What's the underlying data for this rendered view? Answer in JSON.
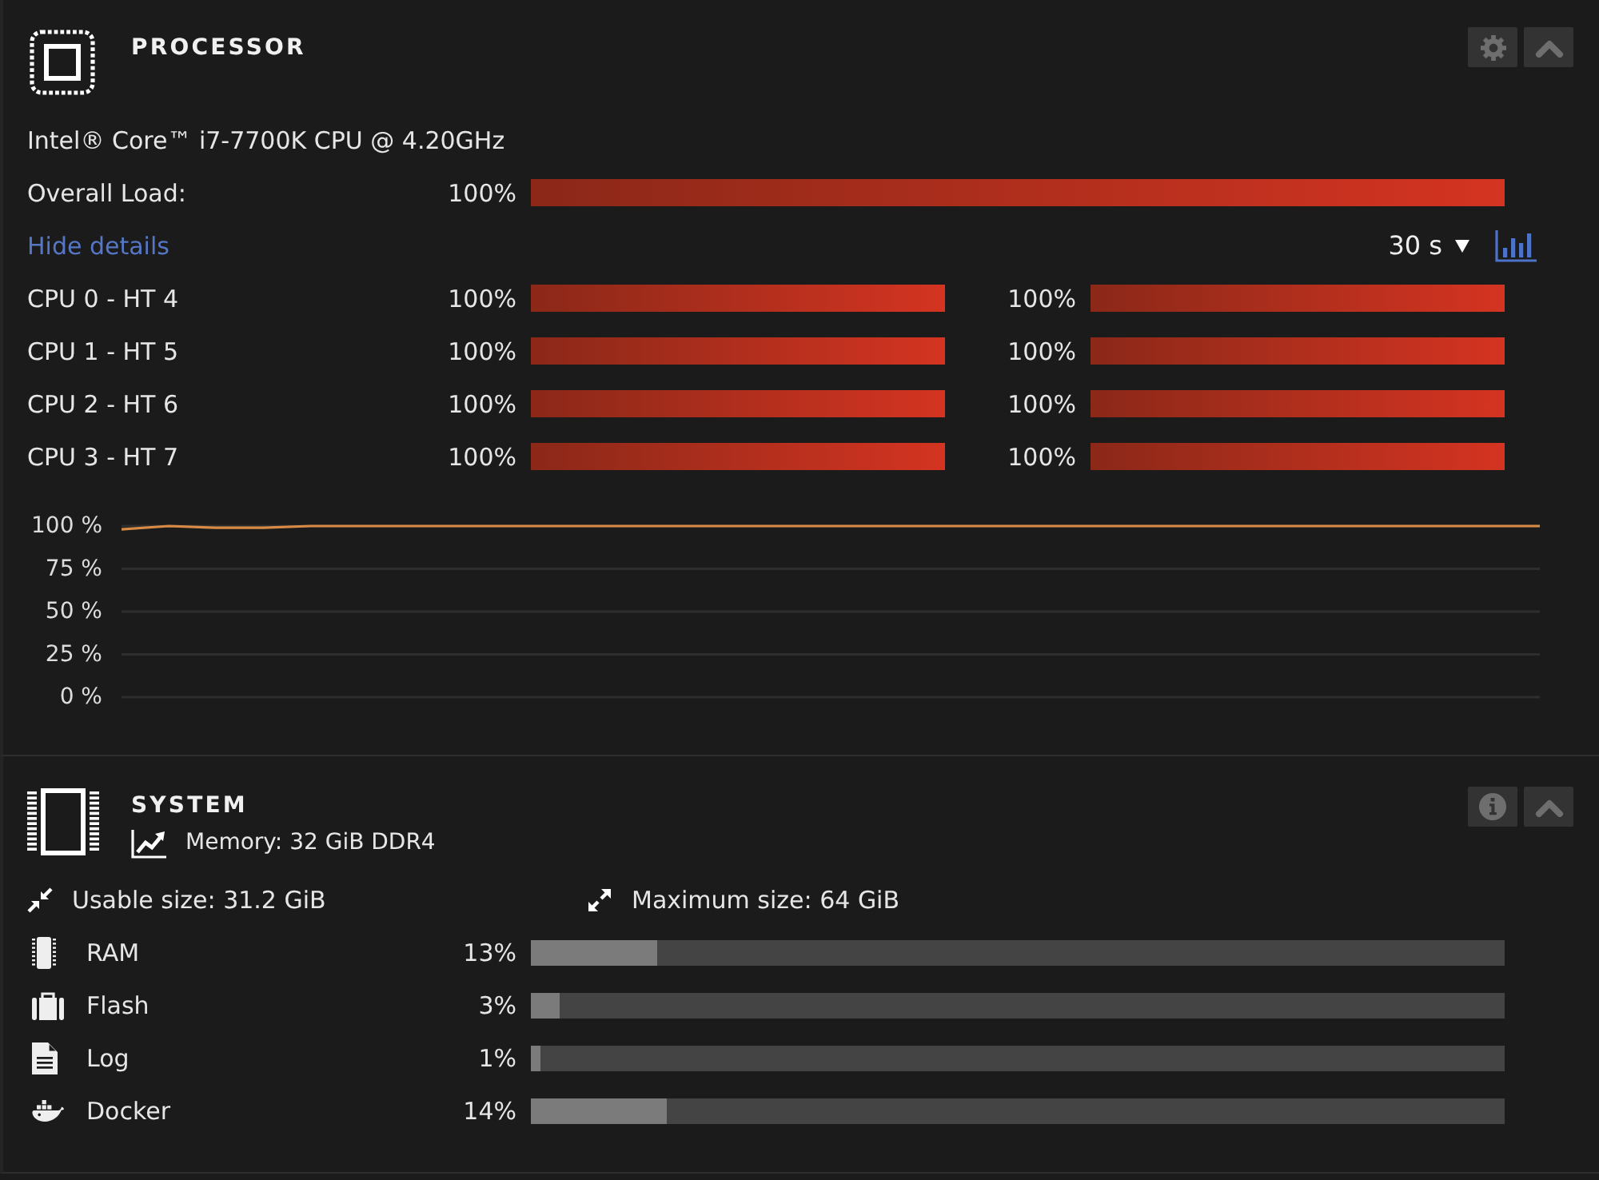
{
  "processor": {
    "title": "PROCESSOR",
    "model": "Intel® Core™ i7-7700K CPU @ 4.20GHz",
    "overall_load": {
      "label": "Overall Load:",
      "reading": "100%",
      "level": 1
    },
    "details_link": "Hide details",
    "time_range": "30 s",
    "cores": [
      {
        "label": "CPU 0 - HT 4",
        "threads": [
          {
            "reading": "100%",
            "level": 1
          },
          {
            "reading": "100%",
            "level": 1
          }
        ]
      },
      {
        "label": "CPU 1 - HT 5",
        "threads": [
          {
            "reading": "100%",
            "level": 1
          },
          {
            "reading": "100%",
            "level": 1
          }
        ]
      },
      {
        "label": "CPU 2 - HT 6",
        "threads": [
          {
            "reading": "100%",
            "level": 1
          },
          {
            "reading": "100%",
            "level": 1
          }
        ]
      },
      {
        "label": "CPU 3 - HT 7",
        "threads": [
          {
            "reading": "100%",
            "level": 1
          },
          {
            "reading": "100%",
            "level": 1
          }
        ]
      }
    ],
    "chart_data": [
      {
        "type": "line",
        "ylim": [
          0,
          100
        ],
        "yticks": [
          {
            "value": 100,
            "label": "100 %"
          },
          {
            "value": 75,
            "label": "75 %"
          },
          {
            "value": 50,
            "label": "50 %"
          },
          {
            "value": 25,
            "label": "25 %"
          },
          {
            "value": 0,
            "label": "0 %"
          }
        ],
        "tick_labels": "y",
        "grid": true,
        "color": "#d98a45",
        "values": [
          98,
          100,
          99,
          99,
          100,
          100,
          100,
          100,
          100,
          100,
          100,
          100,
          100,
          100,
          100,
          100,
          100,
          100,
          100,
          100,
          100,
          100,
          100,
          100,
          100,
          100,
          100,
          100,
          100,
          100,
          100
        ]
      }
    ]
  },
  "system": {
    "title": "SYSTEM",
    "memory": "Memory: 32 GiB DDR4",
    "usable_size": "Usable size: 31.2 GiB",
    "maximum_size": "Maximum size: 64 GiB",
    "usage": [
      {
        "kind": "ram",
        "label": "RAM",
        "reading": "13%",
        "level": 0.13
      },
      {
        "kind": "flash",
        "label": "Flash",
        "reading": "3%",
        "level": 0.03
      },
      {
        "kind": "log",
        "label": "Log",
        "reading": "1%",
        "level": 0.01
      },
      {
        "kind": "docker",
        "label": "Docker",
        "reading": "14%",
        "level": 0.14
      }
    ]
  }
}
